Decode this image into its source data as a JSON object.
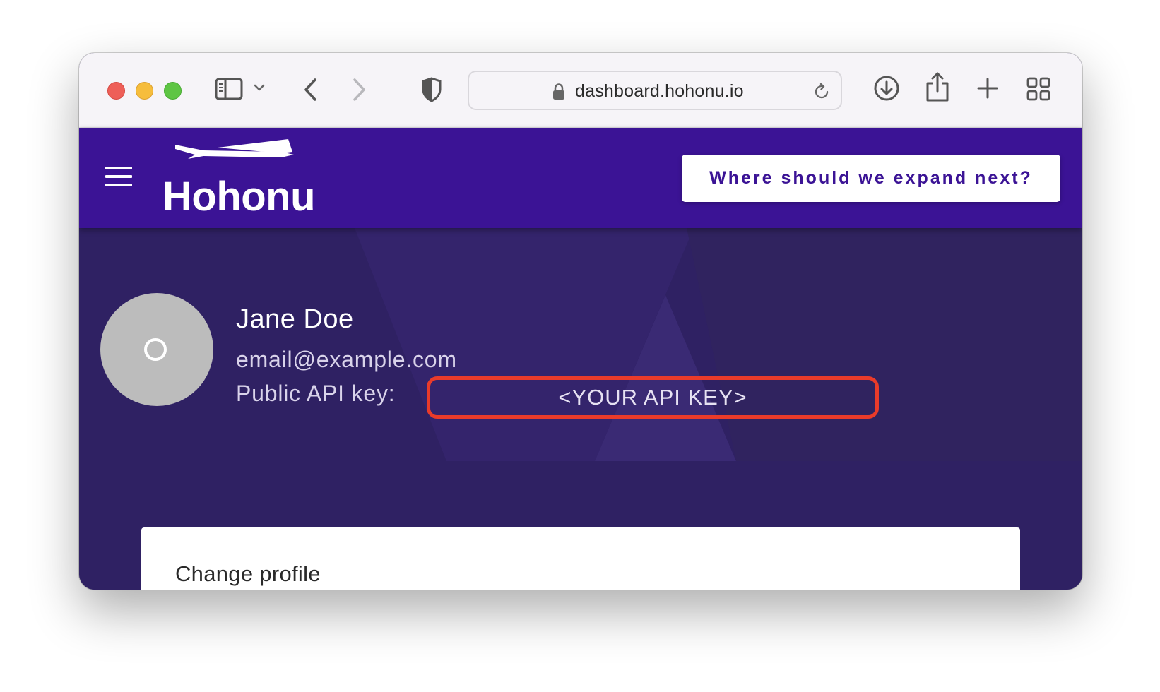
{
  "browser": {
    "url": "dashboard.hohonu.io",
    "icons": [
      "close-icon",
      "minimize-icon",
      "zoom-icon",
      "sidebar-icon",
      "chevron-down-icon",
      "back-icon",
      "forward-icon",
      "shield-icon",
      "lock-icon",
      "reload-icon",
      "download-icon",
      "share-icon",
      "new-tab-icon",
      "tab-overview-icon"
    ]
  },
  "header": {
    "brand": "Hohonu",
    "cta_label": "Where should we expand next?",
    "colors": {
      "header_bg": "#3b1395",
      "band_bg": "#2f2163",
      "highlight": "#ea3b2a"
    }
  },
  "profile": {
    "name": "Jane Doe",
    "email": "email@example.com",
    "api_label": "Public API key:",
    "api_key": "<YOUR API KEY>"
  },
  "card": {
    "title": "Change profile"
  }
}
